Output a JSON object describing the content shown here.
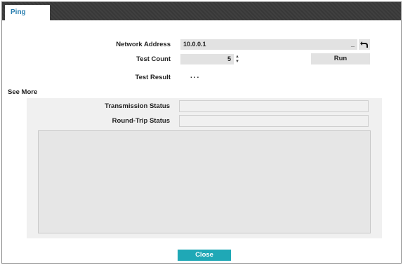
{
  "tabs": [
    {
      "label": "Ping",
      "active": true
    }
  ],
  "form": {
    "network_address_label": "Network Address",
    "network_address_value": "10.0.0.1",
    "network_address_cursor": "_",
    "test_count_label": "Test Count",
    "test_count_value": "5",
    "run_label": "Run",
    "test_result_label": "Test Result",
    "test_result_value": "..."
  },
  "see_more": {
    "title": "See More",
    "transmission_status_label": "Transmission Status",
    "transmission_status_value": "",
    "round_trip_status_label": "Round-Trip Status",
    "round_trip_status_value": ""
  },
  "footer": {
    "close_label": "Close"
  },
  "colors": {
    "tab_text": "#2a7fb0",
    "tabbar_bg": "#3a3a3a",
    "close_button_bg": "#1fa8b6",
    "field_bg": "#e2e2e2",
    "panel_bg": "#f0f0f0"
  },
  "icons": {
    "undo": "undo-arrow-icon",
    "stepper_up": "triangle-up-icon",
    "stepper_down": "triangle-down-icon"
  }
}
